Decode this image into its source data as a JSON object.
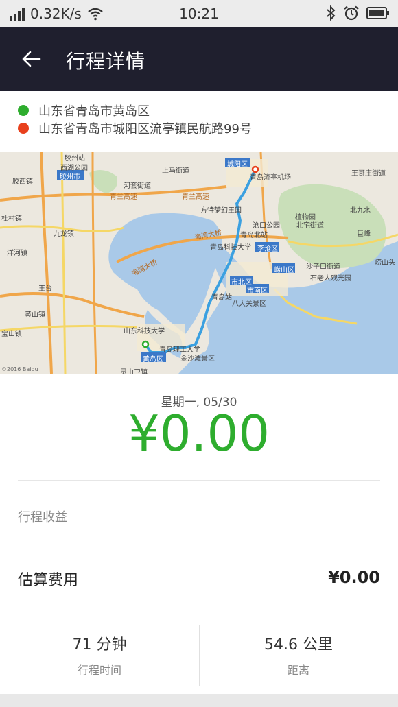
{
  "status_bar": {
    "speed": "0.32K/s",
    "time": "10:21"
  },
  "header": {
    "title": "行程详情"
  },
  "route": {
    "start": {
      "address": "山东省青岛市黄岛区",
      "color": "#2ead2e"
    },
    "end": {
      "address": "山东省青岛市城阳区流亭镇民航路99号",
      "color": "#e8401c"
    }
  },
  "map": {
    "labels": {
      "jiaozhou": "胶州市",
      "xixi": "西湖公园",
      "jiaozhou_station": "胶州站",
      "shangma": "上马街道",
      "chengyang": "城阳区",
      "airport": "青岛流亭机场",
      "xiazhuang": "夏庄街道",
      "huangdao": "黄岛区",
      "licang": "李沧区",
      "shibei": "市北区",
      "shinan": "市南区",
      "laoshan": "崂山区",
      "qingdao_station": "青岛站",
      "qingdao_north": "青岛北站",
      "bay_bridge": "海湾大桥",
      "jiaozhou_bay": "胶州湾",
      "jiaonan": "黄山镇",
      "sci_univ": "山东科技大学",
      "qingli": "青岛理工大学",
      "jinshatan": "金沙滩景区",
      "hetao": "河套街道",
      "zhongxin": "沙子口街道",
      "beijiushui": "北九水",
      "juyong": "巨峰",
      "badaguan": "八大关景区",
      "shilaoren": "石老人观光园",
      "qingdao_tech": "青岛科技大学",
      "cangkou": "沧口公园",
      "botanic": "植物园",
      "wanggezhuang": "王哥庄街道",
      "wangtai": "王台",
      "yanghe": "洋河镇",
      "jiulong": "九龙镇",
      "dujia": "杜村镇",
      "jiaoxi": "胶西镇",
      "baoshan": "宝山镇",
      "lingshan": "灵山卫镇",
      "laoshan_tou": "崂山头",
      "fangte": "方特梦幻王国",
      "beizhai": "北宅街道",
      "qingdao_hi": "青兰高速",
      "copyright": "©2016 Baidu"
    }
  },
  "trip": {
    "date": "星期一, 05/30",
    "amount": "¥0.00"
  },
  "earnings": {
    "section_label": "行程收益",
    "cost_label": "估算费用",
    "cost_value": "¥0.00"
  },
  "stats": {
    "duration_value": "71 分钟",
    "duration_label": "行程时间",
    "distance_value": "54.6 公里",
    "distance_label": "距离"
  }
}
